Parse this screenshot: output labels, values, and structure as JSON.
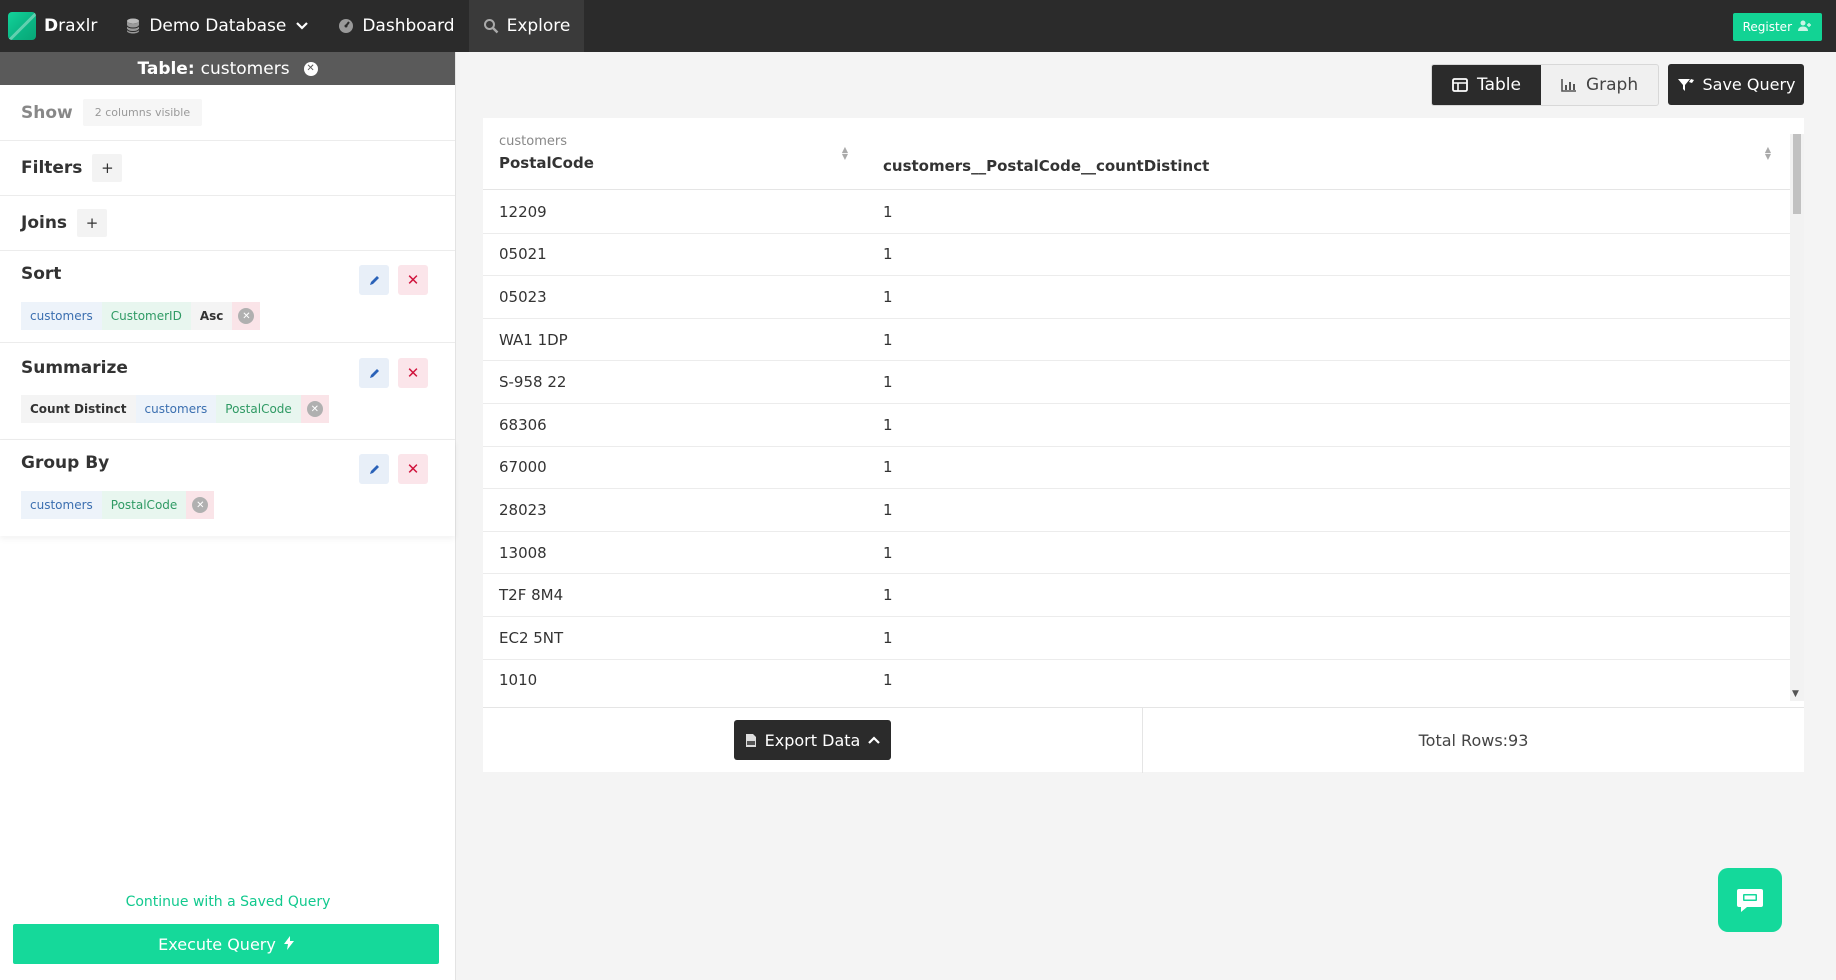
{
  "topbar": {
    "brand": {
      "first": "D",
      "rest": "raxlr"
    },
    "nav": [
      {
        "label": "Demo Database",
        "icon": "database-icon"
      },
      {
        "label": "Dashboard",
        "icon": "dashboard-icon"
      },
      {
        "label": "Explore",
        "icon": "search-icon"
      }
    ],
    "register_label": "Register"
  },
  "sidebar": {
    "table_prefix": "Table:",
    "table_name": "customers",
    "show": {
      "title": "Show",
      "pill": "2 columns visible"
    },
    "filters": {
      "title": "Filters",
      "add": "+"
    },
    "joins": {
      "title": "Joins",
      "add": "+"
    },
    "sort": {
      "title": "Sort",
      "tags": [
        "customers",
        "CustomerID",
        "Asc"
      ]
    },
    "summarize": {
      "title": "Summarize",
      "tags": [
        "Count Distinct",
        "customers",
        "PostalCode"
      ]
    },
    "group_by": {
      "title": "Group By",
      "tags": [
        "customers",
        "PostalCode"
      ]
    },
    "saved_query_link": "Continue with a Saved Query",
    "execute_label": "Execute Query"
  },
  "toolbar": {
    "table_label": "Table",
    "graph_label": "Graph",
    "save_query_label": "Save Query"
  },
  "results": {
    "col1_table": "customers",
    "col1_name": "PostalCode",
    "col2_name": "customers__PostalCode__countDistinct",
    "rows": [
      [
        "12209",
        "1"
      ],
      [
        "05021",
        "1"
      ],
      [
        "05023",
        "1"
      ],
      [
        "WA1 1DP",
        "1"
      ],
      [
        "S-958 22",
        "1"
      ],
      [
        "68306",
        "1"
      ],
      [
        "67000",
        "1"
      ],
      [
        "28023",
        "1"
      ],
      [
        "13008",
        "1"
      ],
      [
        "T2F 8M4",
        "1"
      ],
      [
        "EC2 5NT",
        "1"
      ],
      [
        "1010",
        "1"
      ]
    ],
    "export_label": "Export Data",
    "total_rows": "Total Rows:93"
  },
  "colors": {
    "accent": "#14d99b",
    "dark": "#2b2b2b",
    "danger": "#d0143d",
    "edit": "#2a62b8"
  }
}
